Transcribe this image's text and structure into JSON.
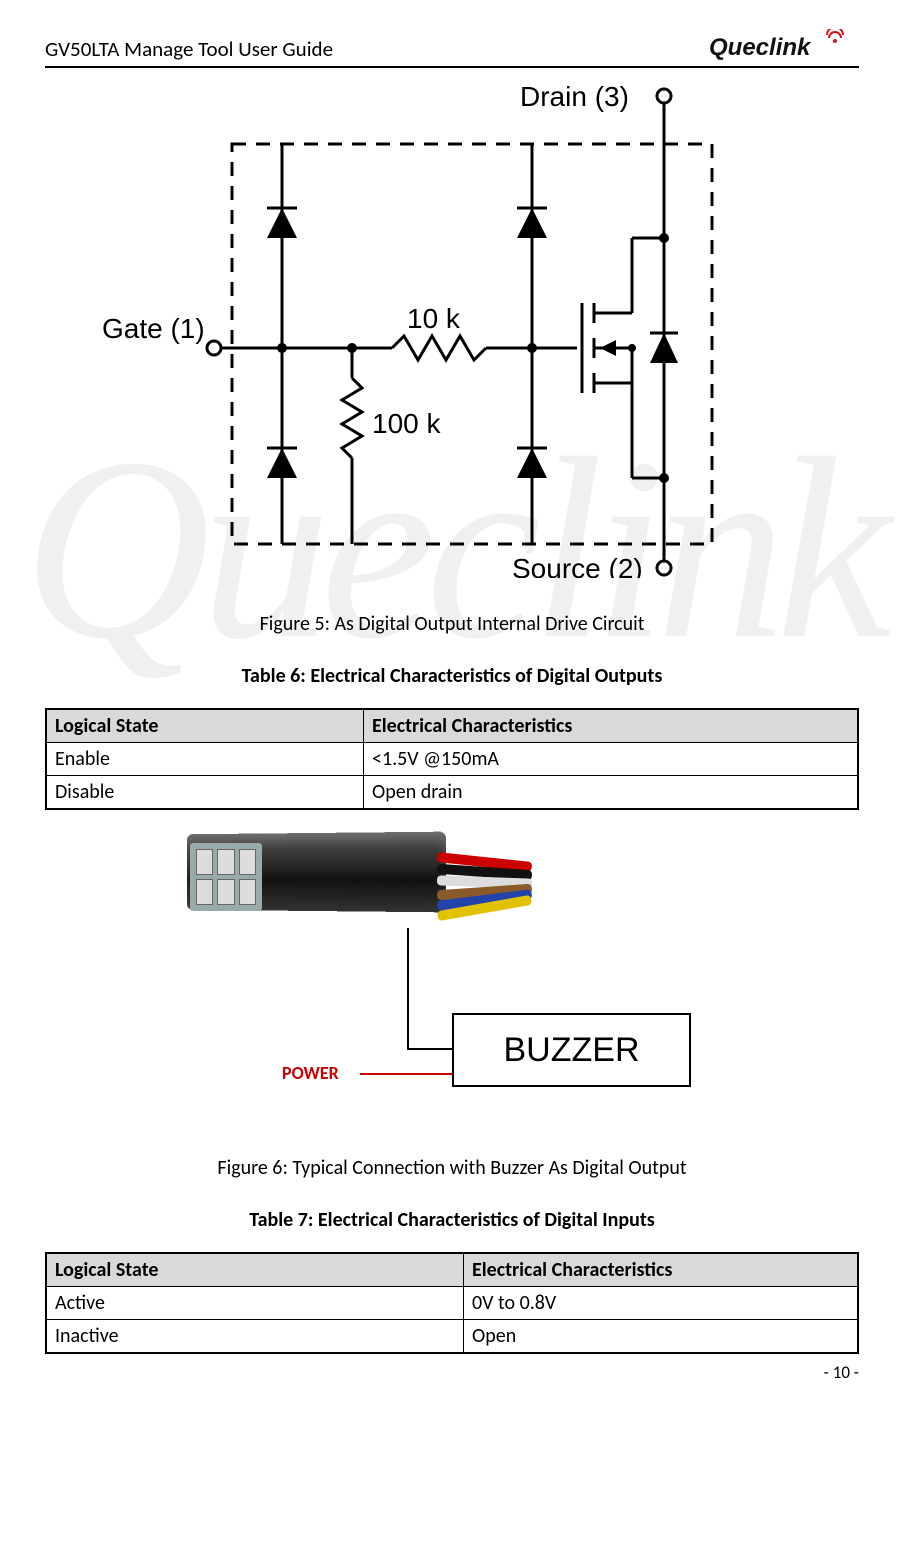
{
  "header": {
    "title": "GV50LTA Manage Tool User Guide",
    "brand": "Queclink"
  },
  "watermark": "Queclink",
  "figure5": {
    "caption": "Figure 5: As Digital Output Internal Drive Circuit",
    "labels": {
      "drain": "Drain (3)",
      "gate": "Gate (1)",
      "source": "Source (2)",
      "r1": "10 k",
      "r2": "100 k"
    }
  },
  "table6": {
    "title": "Table 6: Electrical Characteristics of Digital Outputs",
    "headers": [
      "Logical State",
      "Electrical Characteristics"
    ],
    "rows": [
      {
        "c0": "Enable",
        "c1": "<1.5V @150mA"
      },
      {
        "c0": "Disable",
        "c1": "Open drain"
      }
    ]
  },
  "figure6": {
    "caption": "Figure 6: Typical Connection with Buzzer As Digital Output",
    "box_label": "BUZZER",
    "power_label": "POWER"
  },
  "table7": {
    "title": "Table 7: Electrical Characteristics of Digital Inputs",
    "headers": [
      "Logical State",
      "Electrical Characteristics"
    ],
    "rows": [
      {
        "c0": "Active",
        "c1": "0V to 0.8V"
      },
      {
        "c0": "Inactive",
        "c1": "Open"
      }
    ]
  },
  "footer": {
    "page": "- 10 -"
  }
}
